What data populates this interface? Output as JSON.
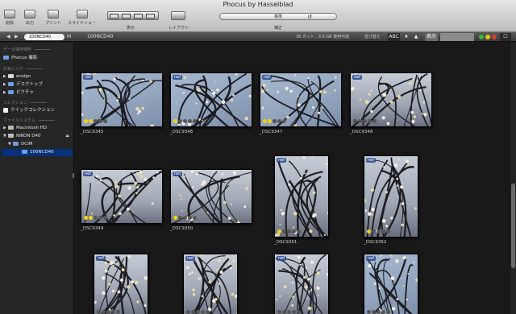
{
  "window": {
    "title": "Phocus by Hasselblad"
  },
  "toolbar": {
    "delete": "削除",
    "export": "出力",
    "print": "プリント",
    "slideshow": "スライドショー",
    "view": "表示",
    "layout": "レイアウト",
    "adjust": "補正",
    "preset": "標準"
  },
  "navbar": {
    "folder": "100NCD40",
    "title": "100NCD40",
    "info": "36 カット , 3.9 GB 使用可能",
    "sort": "並び替え",
    "abc": "ABC",
    "star": "★",
    "zoom_label": "表示"
  },
  "sidebar": {
    "sections": [
      {
        "label": "データ保存場所",
        "items": [
          {
            "label": "Phocus 撮影",
            "icon": "folder-icon"
          }
        ]
      },
      {
        "label": "お気に入り",
        "items": [
          {
            "label": "ensign",
            "icon": "home-icon"
          },
          {
            "label": "デスクトップ",
            "icon": "folder-icon"
          },
          {
            "label": "ピクチャ",
            "icon": "folder-icon"
          }
        ]
      },
      {
        "label": "コレクション",
        "items": [
          {
            "label": "クイックコレクション",
            "icon": "checkbox-icon"
          }
        ]
      },
      {
        "label": "ファイルシステム",
        "items": [
          {
            "label": "Macintosh HD",
            "icon": "disk-icon"
          },
          {
            "label": "NIKON D40",
            "icon": "disk-icon"
          },
          {
            "label": "DCIM",
            "icon": "folder-icon"
          },
          {
            "label": "100NCD40",
            "icon": "folder-icon",
            "selected": true
          }
        ]
      }
    ]
  },
  "thumbnails": [
    {
      "name": "_DSC9345",
      "badge": "nef",
      "rating": 2
    },
    {
      "name": "_DSC9346",
      "badge": "nef",
      "rating": 1
    },
    {
      "name": "_DSC9347",
      "badge": "nef",
      "rating": 2
    },
    {
      "name": "_DSC9348",
      "badge": "nef",
      "rating": 0
    },
    {
      "name": "_DSC9349",
      "badge": "nef",
      "rating": 2
    },
    {
      "name": "_DSC9350",
      "badge": "nef",
      "rating": 1
    },
    {
      "name": "_DSC9351",
      "badge": "nef",
      "rating": 1
    },
    {
      "name": "_DSC9352",
      "badge": "nef",
      "rating": 1
    },
    {
      "name": "",
      "badge": "nef",
      "rating": 0
    },
    {
      "name": "",
      "badge": "nef",
      "rating": 0
    },
    {
      "name": "",
      "badge": "nef",
      "rating": 0
    },
    {
      "name": "",
      "badge": "nef",
      "rating": 0
    }
  ],
  "colors": {
    "selection": "#05327a",
    "rating_active": "#f1d21a",
    "badge": "#28468c"
  }
}
